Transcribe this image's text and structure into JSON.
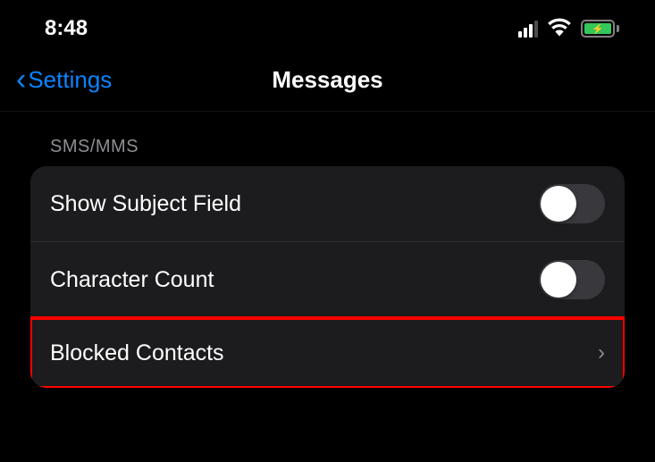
{
  "status": {
    "time": "8:48"
  },
  "nav": {
    "back_label": "Settings",
    "title": "Messages"
  },
  "section": {
    "header": "SMS/MMS"
  },
  "rows": {
    "show_subject": {
      "label": "Show Subject Field",
      "value": false
    },
    "character_count": {
      "label": "Character Count",
      "value": false
    },
    "blocked_contacts": {
      "label": "Blocked Contacts"
    }
  }
}
